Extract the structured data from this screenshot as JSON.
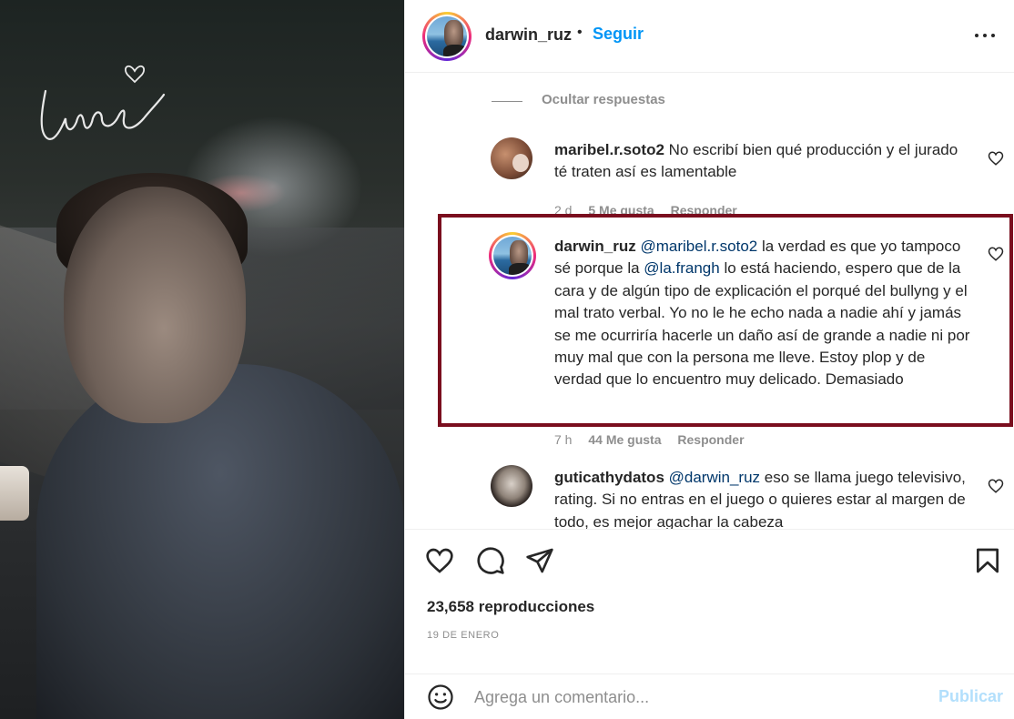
{
  "media": {
    "overlay_text": "Lunes",
    "overlay_icon": "heart-doodle-icon"
  },
  "header": {
    "username": "darwin_ruz",
    "separator": "•",
    "follow_label": "Seguir",
    "more_icon": "more-options-icon"
  },
  "comments": {
    "hide_replies_label": "Ocultar respuestas",
    "items": [
      {
        "username": "maribel.r.soto2",
        "segments": [
          {
            "type": "text",
            "value": "No escribí bien qué producción y el jurado té traten así es lamentable"
          }
        ],
        "time": "2 d",
        "likes": "5 Me gusta",
        "reply_label": "Responder"
      },
      {
        "username": "darwin_ruz",
        "segments": [
          {
            "type": "mention",
            "value": "@maribel.r.soto2"
          },
          {
            "type": "text",
            "value": " la verdad es que yo tampoco sé porque la "
          },
          {
            "type": "mention",
            "value": "@la.frangh"
          },
          {
            "type": "text",
            "value": " lo está haciendo, espero que de la cara y de algún tipo de explicación el porqué del bullyng y el mal trato verbal. Yo no le he echo nada a nadie ahí y jamás se me ocurriría hacerle un daño así de grande a nadie ni por muy mal que con la persona me lleve. Estoy plop y de verdad que lo encuentro muy delicado. Demasiado"
          }
        ],
        "time": "7 h",
        "likes": "44 Me gusta",
        "reply_label": "Responder"
      },
      {
        "username": "guticathydatos",
        "segments": [
          {
            "type": "mention",
            "value": "@darwin_ruz"
          },
          {
            "type": "text",
            "value": " eso se llama juego televisivo, rating. Si no entras en el juego o quieres estar al margen de todo, es mejor agachar la cabeza"
          }
        ]
      }
    ]
  },
  "actions": {
    "views": "23,658 reproducciones",
    "date": "19 DE ENERO",
    "icons": [
      "heart-icon",
      "comment-icon",
      "share-icon",
      "bookmark-icon"
    ]
  },
  "add_comment": {
    "placeholder": "Agrega un comentario...",
    "publish_label": "Publicar"
  },
  "colors": {
    "link": "#0095f6",
    "mention": "#00376b",
    "muted": "#8e8e8e",
    "highlight_border": "#7a0e1e",
    "publish_disabled": "#b2dffc"
  }
}
